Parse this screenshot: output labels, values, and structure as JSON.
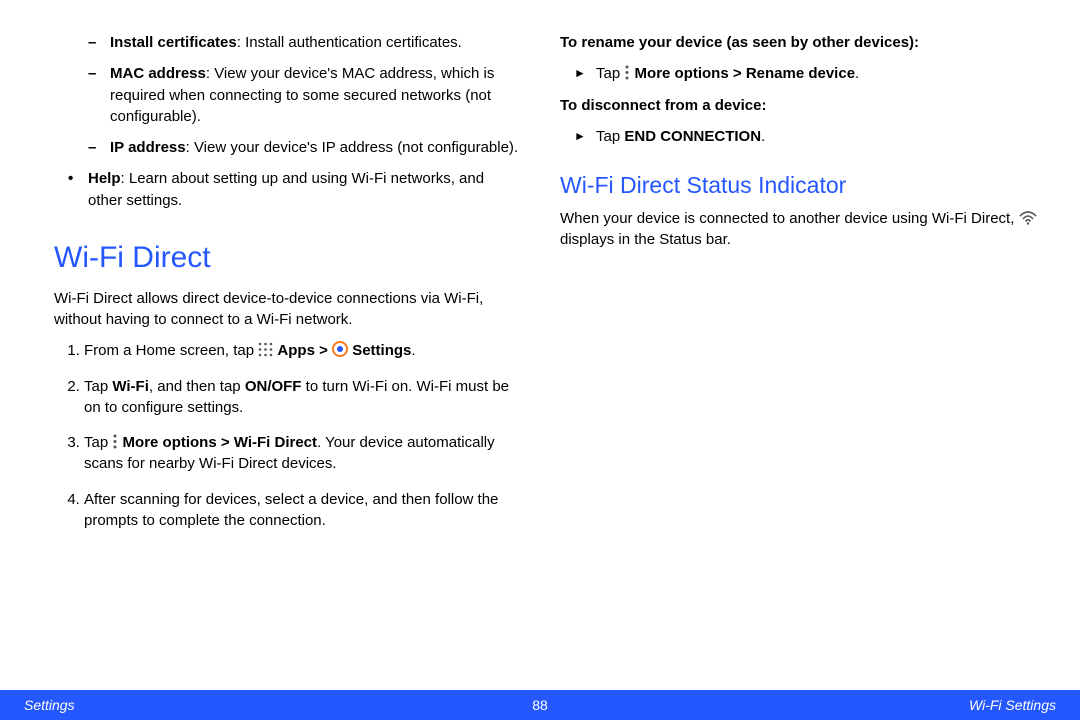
{
  "left": {
    "sub1_label": "Install certificates",
    "sub1_text": ": Install authentication certificates.",
    "sub2_label": "MAC address",
    "sub2_text": ": View your device's MAC address, which is required when connecting to some secured networks (not configurable).",
    "sub3_label": "IP address",
    "sub3_text": ": View your device's IP address (not configurable).",
    "main1_label": "Help",
    "main1_text": ": Learn about setting up and using Wi-Fi networks, and other settings.",
    "h1": "Wi-Fi Direct",
    "intro": "Wi-Fi Direct allows direct device-to-device connections via Wi-Fi, without having to connect to a Wi-Fi network.",
    "step1_a": "From a Home screen, tap ",
    "step1_apps": "Apps",
    "step1_gt": " > ",
    "step1_settings": "Settings",
    "step1_end": ".",
    "step2_a": "Tap ",
    "step2_wifi": "Wi-Fi",
    "step2_b": ", and then tap ",
    "step2_onoff": "ON/OFF",
    "step2_c": " to turn Wi-Fi on. Wi-Fi must be on to configure settings.",
    "step3_a": "Tap ",
    "step3_more": "More options",
    "step3_gt": " > ",
    "step3_wfd": "Wi-Fi Direct",
    "step3_b": ". Your device automatically scans for nearby Wi-Fi Direct devices.",
    "step4": "After scanning for devices, select a device, and then follow the prompts to complete the connection."
  },
  "right": {
    "rename_heading": "To rename your device (as seen by other devices):",
    "rename_a": "Tap ",
    "rename_more": "More options",
    "rename_gt": " > ",
    "rename_b": "Rename device",
    "rename_end": ".",
    "disconnect_heading": "To disconnect from a device:",
    "disconnect_a": "Tap ",
    "disconnect_b": "END CONNECTION",
    "disconnect_end": ".",
    "h2": "Wi-Fi Direct Status Indicator",
    "status_a": "When your device is connected to another device using Wi-Fi Direct, ",
    "status_b": " displays in the Status bar."
  },
  "footer": {
    "left": "Settings",
    "page": "88",
    "right": "Wi-Fi Settings"
  }
}
